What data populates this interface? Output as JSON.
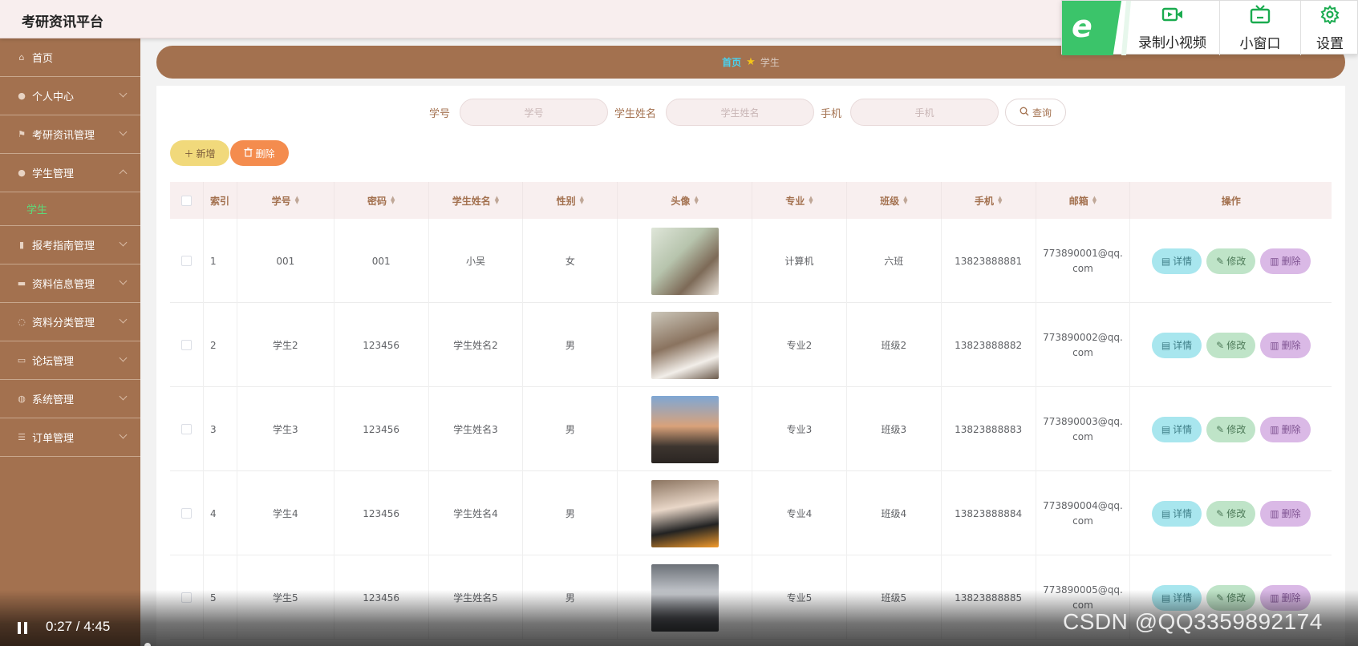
{
  "app": {
    "title": "考研资讯平台"
  },
  "overlay": {
    "record_label": "录制小视频",
    "mini_window_label": "小窗口",
    "settings_label": "设置"
  },
  "sidebar": {
    "items": [
      {
        "label": "首页",
        "icon": "home-icon"
      },
      {
        "label": "个人中心",
        "icon": "user-icon"
      },
      {
        "label": "考研资讯管理",
        "icon": "flag-icon"
      },
      {
        "label": "学生管理",
        "icon": "user-icon",
        "expanded": true,
        "sub": [
          {
            "label": "学生"
          }
        ]
      },
      {
        "label": "报考指南管理",
        "icon": "lock-icon"
      },
      {
        "label": "资料信息管理",
        "icon": "chat-icon"
      },
      {
        "label": "资料分类管理",
        "icon": "loading-icon"
      },
      {
        "label": "论坛管理",
        "icon": "monitor-icon"
      },
      {
        "label": "系统管理",
        "icon": "globe-icon"
      },
      {
        "label": "订单管理",
        "icon": "list-icon"
      }
    ]
  },
  "breadcrumb": {
    "home": "首页",
    "current": "学生"
  },
  "search": {
    "fields": [
      {
        "label": "学号",
        "placeholder": "学号"
      },
      {
        "label": "学生姓名",
        "placeholder": "学生姓名"
      },
      {
        "label": "手机",
        "placeholder": "手机"
      }
    ],
    "query_label": "查询"
  },
  "toolbar": {
    "add_label": "新增",
    "delete_label": "删除"
  },
  "table": {
    "headers": [
      "索引",
      "学号",
      "密码",
      "学生姓名",
      "性别",
      "头像",
      "专业",
      "班级",
      "手机",
      "邮箱",
      "操作"
    ],
    "rows": [
      {
        "index": "1",
        "student_no": "001",
        "password": "001",
        "name": "小吴",
        "gender": "女",
        "major": "计算机",
        "class": "六班",
        "phone": "13823888881",
        "email": "773890001@qq.com"
      },
      {
        "index": "2",
        "student_no": "学生2",
        "password": "123456",
        "name": "学生姓名2",
        "gender": "男",
        "major": "专业2",
        "class": "班级2",
        "phone": "13823888882",
        "email": "773890002@qq.com"
      },
      {
        "index": "3",
        "student_no": "学生3",
        "password": "123456",
        "name": "学生姓名3",
        "gender": "男",
        "major": "专业3",
        "class": "班级3",
        "phone": "13823888883",
        "email": "773890003@qq.com"
      },
      {
        "index": "4",
        "student_no": "学生4",
        "password": "123456",
        "name": "学生姓名4",
        "gender": "男",
        "major": "专业4",
        "class": "班级4",
        "phone": "13823888884",
        "email": "773890004@qq.com"
      },
      {
        "index": "5",
        "student_no": "学生5",
        "password": "123456",
        "name": "学生姓名5",
        "gender": "男",
        "major": "专业5",
        "class": "班级5",
        "phone": "13823888885",
        "email": "773890005@qq.com"
      }
    ],
    "actions": {
      "detail": "详情",
      "edit": "修改",
      "remove": "删除"
    }
  },
  "video": {
    "time": "0:27 / 4:45",
    "watermark": "CSDN @QQ3359892174"
  },
  "colors": {
    "accent": "#a3714f",
    "active_sub": "#5cdb7a",
    "crumb_home": "#4ad1ee",
    "add_btn": "#f1d97b",
    "del_btn": "#f48c4e"
  }
}
